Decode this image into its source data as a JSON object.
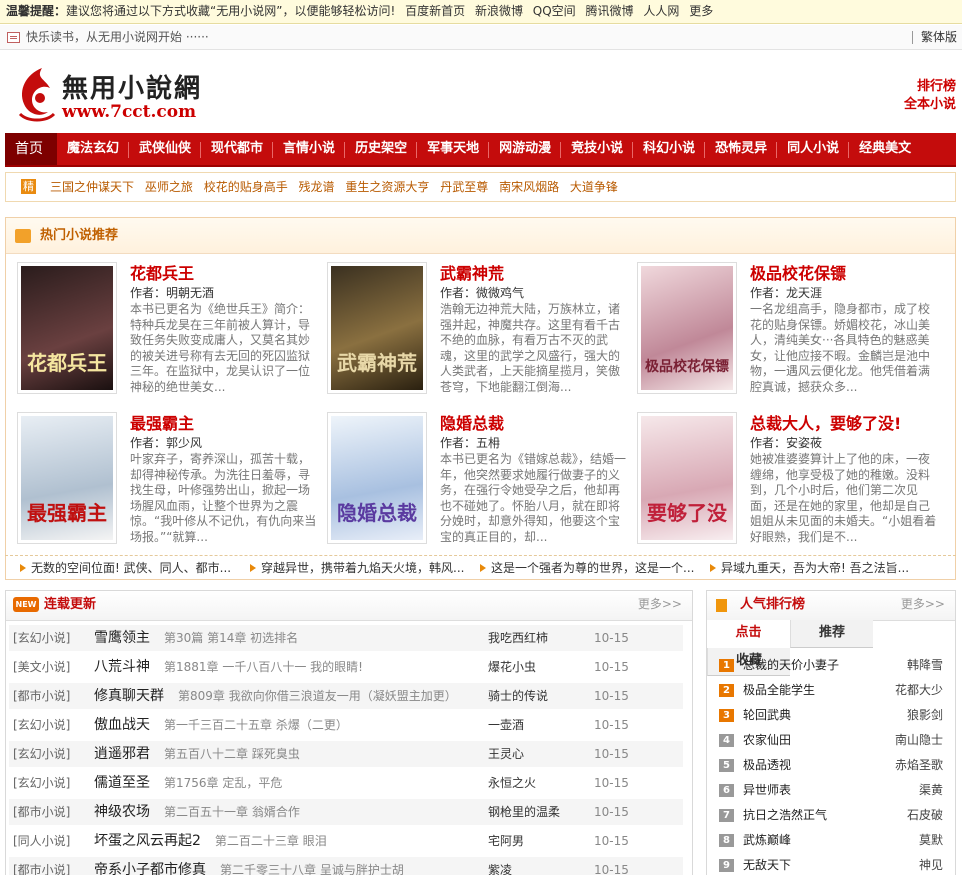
{
  "notice": {
    "label": "温馨提醒：",
    "text": "建议您将通过以下方式收藏“无用小说网”，以便能够轻松访问!",
    "links": [
      "百度新首页",
      "新浪微博",
      "QQ空间",
      "腾讯微博",
      "人人网",
      "更多"
    ]
  },
  "topbar": {
    "slogan": "快乐读书，从无用小说网开始 ······",
    "traditional": "繁体版"
  },
  "logo": {
    "name": "無用小說網",
    "url": "www.7cct.com"
  },
  "header_links": [
    "排行榜",
    "全本小说"
  ],
  "nav": [
    "首页",
    "魔法玄幻",
    "武侠仙侠",
    "现代都市",
    "言情小说",
    "历史架空",
    "军事天地",
    "网游动漫",
    "竞技小说",
    "科幻小说",
    "恐怖灵异",
    "同人小说",
    "经典美文"
  ],
  "featured_tag": "精",
  "featured_links": [
    "三国之仲谋天下",
    "巫师之旅",
    "校花的贴身高手",
    "残龙谱",
    "重生之资源大亨",
    "丹武至尊",
    "南宋风烟路",
    "大道争锋"
  ],
  "hot": {
    "title": "热门小说推荐",
    "books": [
      {
        "title": "花都兵王",
        "author": "作者：明朝无酒",
        "desc": "本书已更名为《绝世兵王》简介：特种兵龙昊在三年前被人算计，导致任务失败变成庸人，又莫名其妙的被关进号称有去无回的死囚监狱三年。在监狱中，龙昊认识了一位神秘的绝世美女...",
        "cover_text": "花都兵王",
        "cover_color": "#3a2a2a"
      },
      {
        "title": "武霸神荒",
        "author": "作者：微微鸡气",
        "desc": "浩翰无边神荒大陆，万族林立，诸强并起，神魔共存。这里有看千古不绝的血脉，有看万古不灭的武魂，这里的武学之风盛行，强大的人类武者，上天能摘星揽月，笑傲苍穹，下地能翻江倒海...",
        "cover_text": "武霸神荒",
        "cover_color": "#5a4a2e"
      },
      {
        "title": "极品校花保镖",
        "author": "作者：龙天涯",
        "desc": "一名龙组高手，隐身都市，成了校花的贴身保镖。娇媚校花，冰山美人，清纯美女···各具特色的魅惑美女，让他应接不暇。金麟岂是池中物，一遇风云便化龙。他凭借着满腔真诚，撼获众多...",
        "cover_text": "极品校花保镖",
        "cover_color": "#a86a7a"
      },
      {
        "title": "最强霸主",
        "author": "作者：郭少风",
        "desc": "叶家弃子，寄养深山，孤苦十载，却得神秘传承。为洗往日羞辱，寻找生母，叶修强势出山，掀起一场场腥风血雨，让整个世界为之震惊。“我叶修从不记仇，有仇向来当场报。”“就算...",
        "cover_text": "最强霸主",
        "cover_color": "#c8d0d8"
      },
      {
        "title": "隐婚总裁",
        "author": "作者：五枏",
        "desc": "本书已更名为《错嫁总裁》，结婚一年，他突然要求她履行做妻子的义务，在强行令她受孕之后，他却再也不碰她了。怀胎八月，就在即将分娩时，却意外得知，他要这个宝宝的真正目的，却...",
        "cover_text": "隐婚总裁",
        "cover_color": "#b8c8e0"
      },
      {
        "title": "总裁大人，要够了没!",
        "author": "作者：安姿莜",
        "desc": "她被准婆婆算计上了他的床，一夜缠绵，他享受极了她的稚嫩。没料到，几个小时后，他们第二次见面，还是在她的家里，他却是自己姐姐从未见面的未婚夫。“小姐看着好眼熟，我们是不...",
        "cover_text": "要够了没",
        "cover_color": "#e0c0c8"
      }
    ],
    "ticker": [
      "无数的空间位面! 武侠、同人、都市...",
      "穿越异世，携带着九焰天火境，韩风...",
      "这是一个强者为尊的世界，这是一个...",
      "异域九重天，吾为大帝! 吾之法旨..."
    ]
  },
  "updates": {
    "title": "连载更新",
    "more": "更多>>",
    "rows": [
      {
        "cat": "[玄幻小说]",
        "name": "雪鹰领主",
        "chap": "第30篇 第14章 初选排名",
        "author": "我吃西红柿",
        "date": "10-15"
      },
      {
        "cat": "[美文小说]",
        "name": "八荒斗神",
        "chap": "第1881章 一千八百八十一 我的眼睛!",
        "author": "爆花小虫",
        "date": "10-15"
      },
      {
        "cat": "[都市小说]",
        "name": "修真聊天群",
        "chap": "第809章 我欲向你借三浪道友一用（凝妖盟主加更）",
        "author": "骑士的传说",
        "date": "10-15"
      },
      {
        "cat": "[玄幻小说]",
        "name": "傲血战天",
        "chap": "第一千三百二十五章 杀爆（二更）",
        "author": "一壶酒",
        "date": "10-15"
      },
      {
        "cat": "[玄幻小说]",
        "name": "逍遥邪君",
        "chap": "第五百八十二章 踩死臭虫",
        "author": "王灵心",
        "date": "10-15"
      },
      {
        "cat": "[玄幻小说]",
        "name": "儒道至圣",
        "chap": "第1756章 定乱，平危",
        "author": "永恒之火",
        "date": "10-15"
      },
      {
        "cat": "[都市小说]",
        "name": "神级农场",
        "chap": "第二百五十一章 翁婿合作",
        "author": "钢枪里的温柔",
        "date": "10-15"
      },
      {
        "cat": "[同人小说]",
        "name": "坏蛋之风云再起2",
        "chap": "第二百二十三章 眼泪",
        "author": "宅阿男",
        "date": "10-15"
      },
      {
        "cat": "[都市小说]",
        "name": "帝系小子都市修真",
        "chap": "第二千零三十八章 呈诚与胖护士胡",
        "author": "紫凌",
        "date": "10-15"
      }
    ]
  },
  "rank": {
    "title": "人气排行榜",
    "more": "更多>>",
    "tabs": [
      "点击",
      "推荐",
      "收藏"
    ],
    "items": [
      {
        "num": "1",
        "name": "总裁的天价小妻子",
        "author": "韩降雪"
      },
      {
        "num": "2",
        "name": "极品全能学生",
        "author": "花都大少"
      },
      {
        "num": "3",
        "name": "轮回武典",
        "author": "狼影剑"
      },
      {
        "num": "4",
        "name": "农家仙田",
        "author": "南山隐士"
      },
      {
        "num": "5",
        "name": "极品透视",
        "author": "赤焰圣歌"
      },
      {
        "num": "6",
        "name": "异世师表",
        "author": "渠黄"
      },
      {
        "num": "7",
        "name": "抗日之浩然正气",
        "author": "石皮破"
      },
      {
        "num": "8",
        "name": "武炼巅峰",
        "author": "莫默"
      },
      {
        "num": "9",
        "name": "无敌天下",
        "author": "神见"
      }
    ]
  }
}
